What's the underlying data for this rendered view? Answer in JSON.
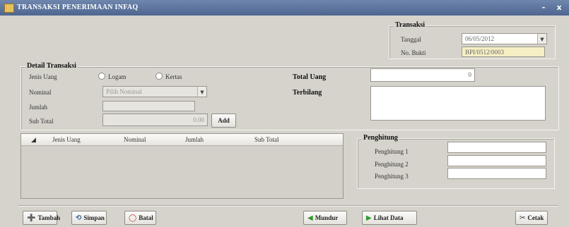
{
  "window": {
    "title": "TRANSAKSI PENERIMAAN INFAQ",
    "minimize": "-",
    "close": "x"
  },
  "transaksi": {
    "legend": "Transaksi",
    "tanggal_label": "Tanggal",
    "tanggal_value": "06/05/2012",
    "nobukti_label": "No. Bukti",
    "nobukti_value": "BPI/0512/0003"
  },
  "detail": {
    "legend": "Detail Transaksi",
    "jenis_uang_label": "Jenis Uang",
    "radio_logam": "Logam",
    "radio_kertas": "Kertas",
    "nominal_label": "Nominal",
    "nominal_placeholder": "Pilih Nominal",
    "jumlah_label": "Jumlah",
    "jumlah_value": "",
    "subtotal_label": "Sub Total",
    "subtotal_value": "0.00",
    "add_label": "Add",
    "total_uang_label": "Total Uang",
    "total_uang_value": "0",
    "terbilang_label": "Terbilang"
  },
  "table": {
    "columns": [
      "Jenis Uang",
      "Nominal",
      "Jumlah",
      "Sub Total"
    ],
    "rows": []
  },
  "penghitung": {
    "legend": "Penghitung",
    "items": [
      "Penghitung 1",
      "Penghitung 2",
      "Penghitung 3"
    ]
  },
  "toolbar": {
    "tambah": "Tambah",
    "simpan": "Simpan",
    "batal": "Batal",
    "mundur": "Mundur",
    "lihat_data": "Lihat Data",
    "cetak": "Cetak"
  },
  "colors": {
    "titlebar": "#5a729a",
    "panel": "#d6d3cc",
    "highlight_field": "#f6efc4"
  }
}
